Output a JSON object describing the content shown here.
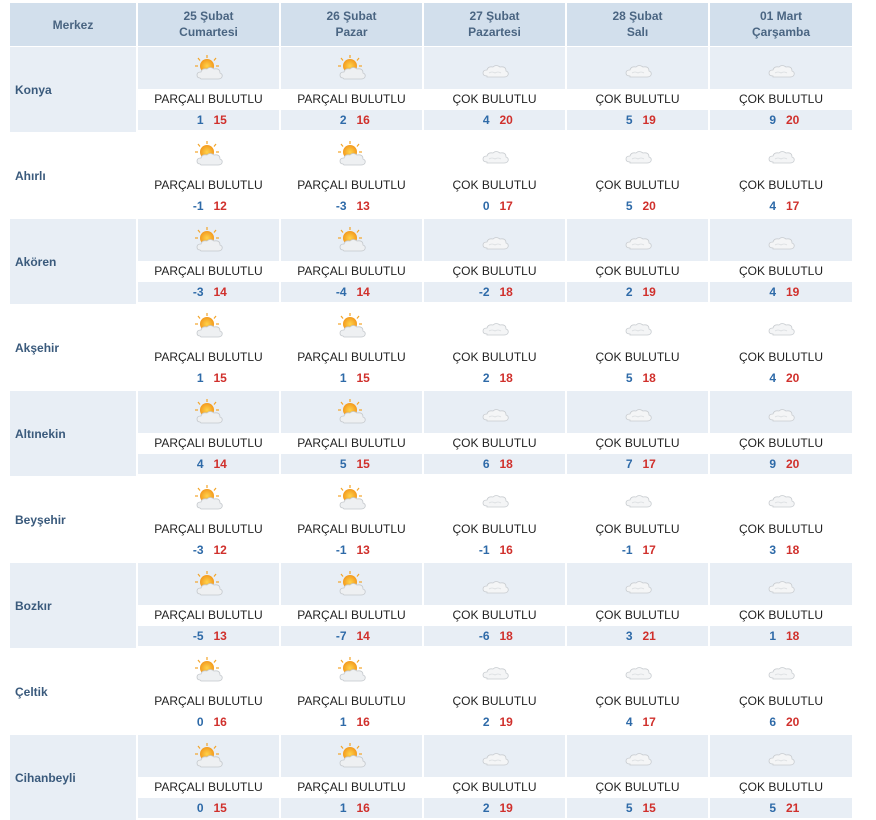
{
  "header": {
    "city_label": "Merkez",
    "days": [
      {
        "date": "25 Şubat",
        "weekday": "Cumartesi"
      },
      {
        "date": "26 Şubat",
        "weekday": "Pazar"
      },
      {
        "date": "27 Şubat",
        "weekday": "Pazartesi"
      },
      {
        "date": "28 Şubat",
        "weekday": "Salı"
      },
      {
        "date": "01 Mart",
        "weekday": "Çarşamba"
      }
    ]
  },
  "colors": {
    "min_temp": "#2e6aa8",
    "max_temp": "#d0302c",
    "header_bg": "#d2dfec",
    "alt_row_bg": "#e8eef5"
  },
  "rows": [
    {
      "city": "Konya",
      "days": [
        {
          "icon": "partly-cloudy-icon",
          "desc": "PARÇALI BULUTLU",
          "min": "1",
          "max": "15"
        },
        {
          "icon": "partly-cloudy-icon",
          "desc": "PARÇALI BULUTLU",
          "min": "2",
          "max": "16"
        },
        {
          "icon": "cloudy-icon",
          "desc": "ÇOK BULUTLU",
          "min": "4",
          "max": "20"
        },
        {
          "icon": "cloudy-icon",
          "desc": "ÇOK BULUTLU",
          "min": "5",
          "max": "19"
        },
        {
          "icon": "cloudy-icon",
          "desc": "ÇOK BULUTLU",
          "min": "9",
          "max": "20"
        }
      ]
    },
    {
      "city": "Ahırlı",
      "days": [
        {
          "icon": "partly-cloudy-icon",
          "desc": "PARÇALI BULUTLU",
          "min": "-1",
          "max": "12"
        },
        {
          "icon": "partly-cloudy-icon",
          "desc": "PARÇALI BULUTLU",
          "min": "-3",
          "max": "13"
        },
        {
          "icon": "cloudy-icon",
          "desc": "ÇOK BULUTLU",
          "min": "0",
          "max": "17"
        },
        {
          "icon": "cloudy-icon",
          "desc": "ÇOK BULUTLU",
          "min": "5",
          "max": "20"
        },
        {
          "icon": "cloudy-icon",
          "desc": "ÇOK BULUTLU",
          "min": "4",
          "max": "17"
        }
      ]
    },
    {
      "city": "Akören",
      "days": [
        {
          "icon": "partly-cloudy-icon",
          "desc": "PARÇALI BULUTLU",
          "min": "-3",
          "max": "14"
        },
        {
          "icon": "partly-cloudy-icon",
          "desc": "PARÇALI BULUTLU",
          "min": "-4",
          "max": "14"
        },
        {
          "icon": "cloudy-icon",
          "desc": "ÇOK BULUTLU",
          "min": "-2",
          "max": "18"
        },
        {
          "icon": "cloudy-icon",
          "desc": "ÇOK BULUTLU",
          "min": "2",
          "max": "19"
        },
        {
          "icon": "cloudy-icon",
          "desc": "ÇOK BULUTLU",
          "min": "4",
          "max": "19"
        }
      ]
    },
    {
      "city": "Akşehir",
      "days": [
        {
          "icon": "partly-cloudy-icon",
          "desc": "PARÇALI BULUTLU",
          "min": "1",
          "max": "15"
        },
        {
          "icon": "partly-cloudy-icon",
          "desc": "PARÇALI BULUTLU",
          "min": "1",
          "max": "15"
        },
        {
          "icon": "cloudy-icon",
          "desc": "ÇOK BULUTLU",
          "min": "2",
          "max": "18"
        },
        {
          "icon": "cloudy-icon",
          "desc": "ÇOK BULUTLU",
          "min": "5",
          "max": "18"
        },
        {
          "icon": "cloudy-icon",
          "desc": "ÇOK BULUTLU",
          "min": "4",
          "max": "20"
        }
      ]
    },
    {
      "city": "Altınekin",
      "days": [
        {
          "icon": "partly-cloudy-icon",
          "desc": "PARÇALI BULUTLU",
          "min": "4",
          "max": "14"
        },
        {
          "icon": "partly-cloudy-icon",
          "desc": "PARÇALI BULUTLU",
          "min": "5",
          "max": "15"
        },
        {
          "icon": "cloudy-icon",
          "desc": "ÇOK BULUTLU",
          "min": "6",
          "max": "18"
        },
        {
          "icon": "cloudy-icon",
          "desc": "ÇOK BULUTLU",
          "min": "7",
          "max": "17"
        },
        {
          "icon": "cloudy-icon",
          "desc": "ÇOK BULUTLU",
          "min": "9",
          "max": "20"
        }
      ]
    },
    {
      "city": "Beyşehir",
      "days": [
        {
          "icon": "partly-cloudy-icon",
          "desc": "PARÇALI BULUTLU",
          "min": "-3",
          "max": "12"
        },
        {
          "icon": "partly-cloudy-icon",
          "desc": "PARÇALI BULUTLU",
          "min": "-1",
          "max": "13"
        },
        {
          "icon": "cloudy-icon",
          "desc": "ÇOK BULUTLU",
          "min": "-1",
          "max": "16"
        },
        {
          "icon": "cloudy-icon",
          "desc": "ÇOK BULUTLU",
          "min": "-1",
          "max": "17"
        },
        {
          "icon": "cloudy-icon",
          "desc": "ÇOK BULUTLU",
          "min": "3",
          "max": "18"
        }
      ]
    },
    {
      "city": "Bozkır",
      "days": [
        {
          "icon": "partly-cloudy-icon",
          "desc": "PARÇALI BULUTLU",
          "min": "-5",
          "max": "13"
        },
        {
          "icon": "partly-cloudy-icon",
          "desc": "PARÇALI BULUTLU",
          "min": "-7",
          "max": "14"
        },
        {
          "icon": "cloudy-icon",
          "desc": "ÇOK BULUTLU",
          "min": "-6",
          "max": "18"
        },
        {
          "icon": "cloudy-icon",
          "desc": "ÇOK BULUTLU",
          "min": "3",
          "max": "21"
        },
        {
          "icon": "cloudy-icon",
          "desc": "ÇOK BULUTLU",
          "min": "1",
          "max": "18"
        }
      ]
    },
    {
      "city": "Çeltik",
      "days": [
        {
          "icon": "partly-cloudy-icon",
          "desc": "PARÇALI BULUTLU",
          "min": "0",
          "max": "16"
        },
        {
          "icon": "partly-cloudy-icon",
          "desc": "PARÇALI BULUTLU",
          "min": "1",
          "max": "16"
        },
        {
          "icon": "cloudy-icon",
          "desc": "ÇOK BULUTLU",
          "min": "2",
          "max": "19"
        },
        {
          "icon": "cloudy-icon",
          "desc": "ÇOK BULUTLU",
          "min": "4",
          "max": "17"
        },
        {
          "icon": "cloudy-icon",
          "desc": "ÇOK BULUTLU",
          "min": "6",
          "max": "20"
        }
      ]
    },
    {
      "city": "Cihanbeyli",
      "days": [
        {
          "icon": "partly-cloudy-icon",
          "desc": "PARÇALI BULUTLU",
          "min": "0",
          "max": "15"
        },
        {
          "icon": "partly-cloudy-icon",
          "desc": "PARÇALI BULUTLU",
          "min": "1",
          "max": "16"
        },
        {
          "icon": "cloudy-icon",
          "desc": "ÇOK BULUTLU",
          "min": "2",
          "max": "19"
        },
        {
          "icon": "cloudy-icon",
          "desc": "ÇOK BULUTLU",
          "min": "5",
          "max": "15"
        },
        {
          "icon": "cloudy-icon",
          "desc": "ÇOK BULUTLU",
          "min": "5",
          "max": "21"
        }
      ]
    }
  ]
}
